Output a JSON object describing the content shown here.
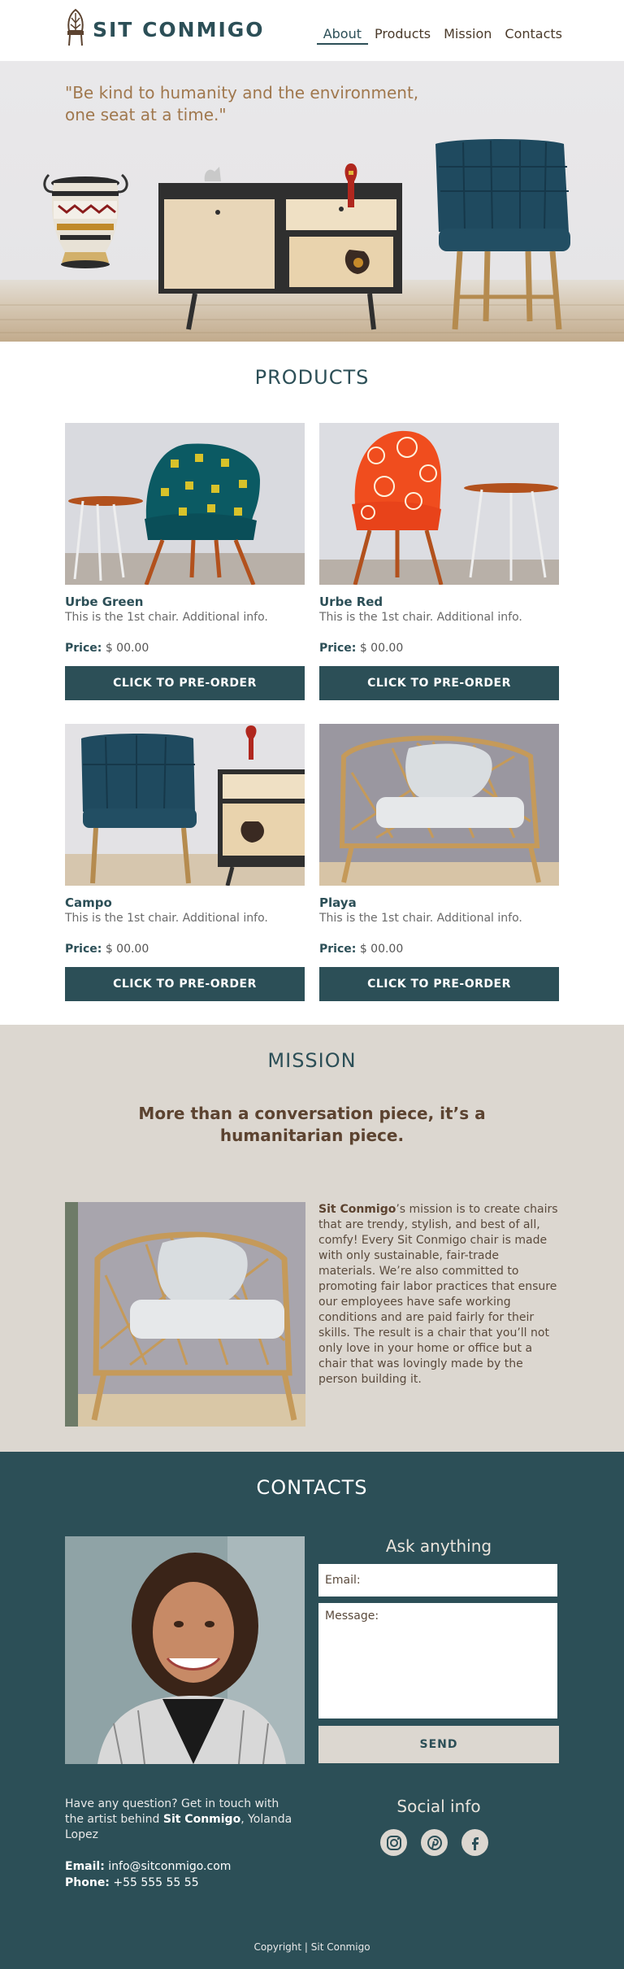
{
  "header": {
    "brand": "SIT CONMIGO",
    "nav": [
      {
        "label": "About",
        "active": true
      },
      {
        "label": "Products",
        "active": false
      },
      {
        "label": "Mission",
        "active": false
      },
      {
        "label": "Contacts",
        "active": false
      }
    ]
  },
  "hero": {
    "quote_line1": "\"Be kind to humanity and the environment,",
    "quote_line2": "one seat at a time.\""
  },
  "products": {
    "title": "PRODUCTS",
    "items": [
      {
        "name": "Urbe Green",
        "desc": "This is the 1st chair. Additional info.",
        "price_label": "Price:",
        "price": "$ 00.00",
        "button": "CLICK TO PRE-ORDER"
      },
      {
        "name": "Urbe Red",
        "desc": "This is the 1st chair. Additional info.",
        "price_label": "Price:",
        "price": "$ 00.00",
        "button": "CLICK TO PRE-ORDER"
      },
      {
        "name": "Campo",
        "desc": "This is the 1st chair. Additional info.",
        "price_label": "Price:",
        "price": "$ 00.00",
        "button": "CLICK TO PRE-ORDER"
      },
      {
        "name": "Playa",
        "desc": "This is the 1st chair. Additional info.",
        "price_label": "Price:",
        "price": "$ 00.00",
        "button": "CLICK TO PRE-ORDER"
      }
    ]
  },
  "mission": {
    "title": "MISSION",
    "lead": "More than a conversation piece, it’s a humanitarian piece.",
    "brand": "Sit Conmigo",
    "body": "’s mission is to create chairs that are trendy, stylish, and best of all, comfy! Every Sit Conmigo chair is made with only sustainable, fair-trade materials. We’re also committed to promoting fair labor practices that ensure our employees have safe working conditions and are paid fairly for their skills. The result is a chair that you’ll not only love in your home or office but a chair that was lovingly made by the person building it."
  },
  "contacts": {
    "title": "CONTACTS",
    "form_title": "Ask anything",
    "email_placeholder": "Email:",
    "message_placeholder": "Message:",
    "send_label": "SEND",
    "intro_before": "Have any question? Get in touch with the artist behind ",
    "intro_brand": "Sit Conmigo",
    "intro_after": ", Yolanda Lopez",
    "email_label": "Email:",
    "email": "info@sitconmigo.com",
    "phone_label": "Phone:",
    "phone": "+55 555 55 55",
    "social_title": "Social info",
    "social": [
      "instagram-icon",
      "pinterest-icon",
      "facebook-icon"
    ],
    "copyright": "Copyright | Sit Conmigo"
  },
  "colors": {
    "primary": "#2c4f57",
    "sand": "#dcd7d0",
    "brown": "#5c4330",
    "quote": "#a0784e"
  }
}
